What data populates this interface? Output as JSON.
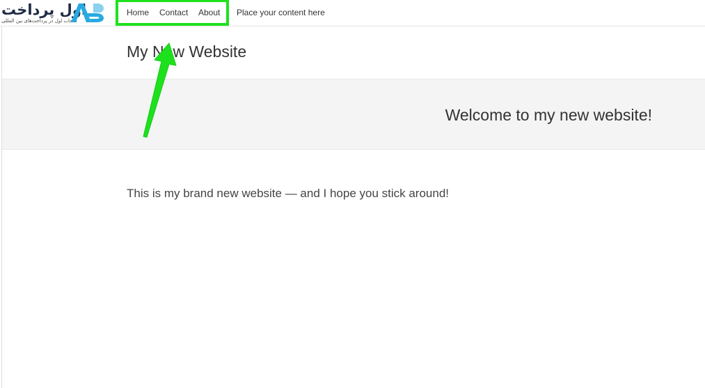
{
  "logo": {
    "text": "اول پرداخت",
    "tagline": "انتخاب اول در پرداخت‌های بین المللی",
    "mark": "AP",
    "brand_color": "#29a9e1"
  },
  "nav": {
    "items": [
      {
        "label": "Home"
      },
      {
        "label": "Contact"
      },
      {
        "label": "About"
      }
    ],
    "placeholder": "Place your content here"
  },
  "page": {
    "site_title": "My New Website",
    "hero_heading": "Welcome to my new website!",
    "intro": "This is my brand new website — and I hope you stick around!"
  },
  "annotation": {
    "color": "#1ee11e",
    "arrow_icon": "arrow-up-icon"
  }
}
